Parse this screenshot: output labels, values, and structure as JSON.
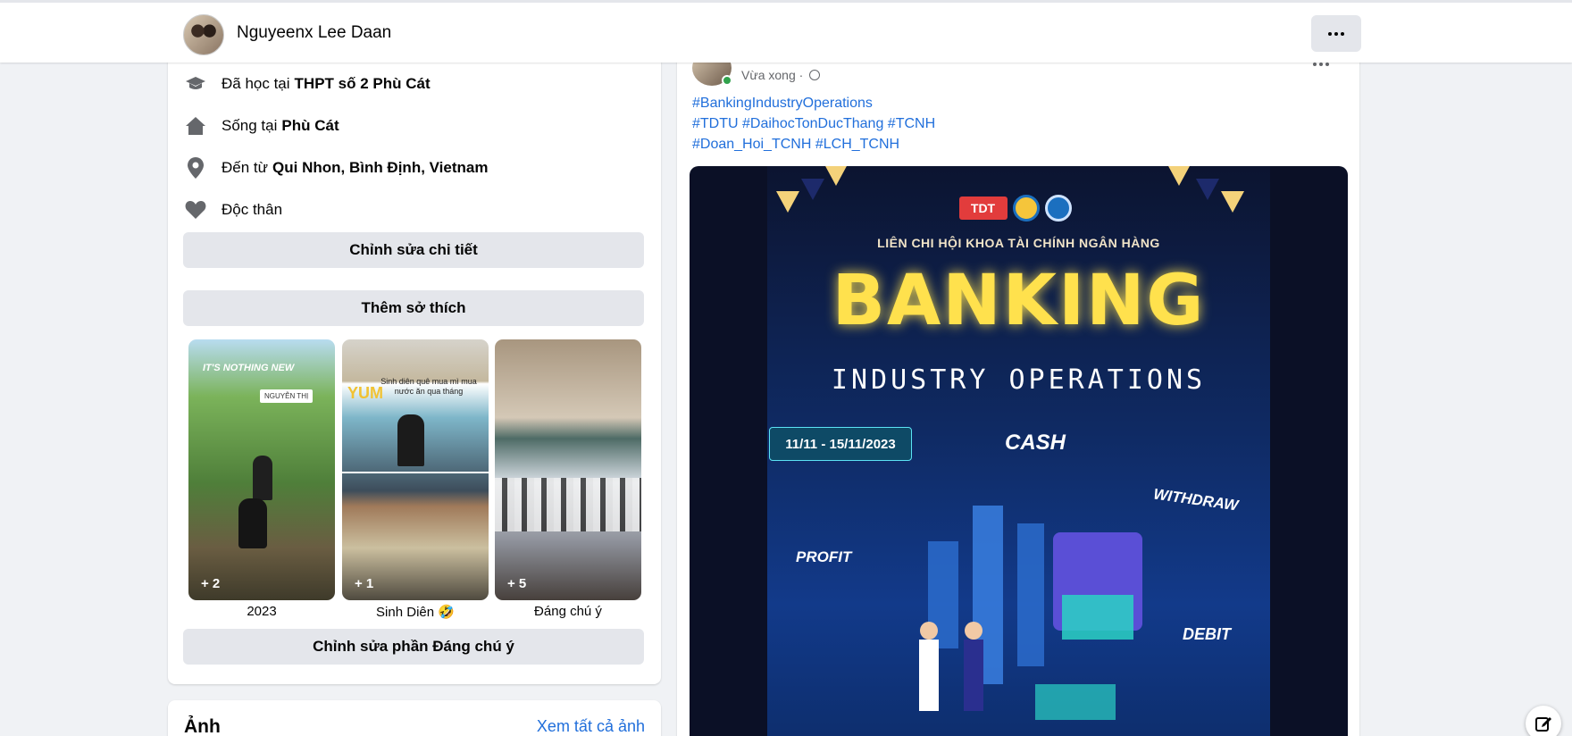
{
  "header": {
    "name": "Nguyeenx Lee Daan",
    "more_icon": "more-horizontal-icon"
  },
  "intro": {
    "items": [
      {
        "icon": "graduation-cap-icon",
        "prefix": "Đã học tại",
        "value": "THPT số 2 Phù Cát"
      },
      {
        "icon": "home-icon",
        "prefix": "Sống tại",
        "value": "Phù Cát"
      },
      {
        "icon": "location-pin-icon",
        "prefix": "Đến từ",
        "value": "Qui Nhon, Bình Định, Vietnam"
      },
      {
        "icon": "heart-icon",
        "prefix": "Độc thân",
        "value": ""
      }
    ],
    "edit_details_label": "Chỉnh sửa chi tiết",
    "add_hobbies_label": "Thêm sở thích",
    "highlights": [
      {
        "label": "2023",
        "count": "+ 2",
        "overlay_text": "IT'S NOTHING NEW",
        "tag": "NGUYỄN THỊ"
      },
      {
        "label": "Sinh Diên 🤣",
        "count": "+ 1",
        "overlay_text": "Sinh diên quê mua mì mua nước ăn qua tháng",
        "tag": "YUM"
      },
      {
        "label": "Đáng chú ý",
        "count": "+ 5",
        "overlay_text": "",
        "tag": ""
      }
    ],
    "edit_featured_label": "Chỉnh sửa phần Đáng chú ý"
  },
  "photos": {
    "title": "Ảnh",
    "see_all": "Xem tất cả ảnh"
  },
  "post": {
    "time": "Vừa xong ·",
    "privacy_icon": "globe-icon",
    "hashtags": [
      [
        "#BankingIndustryOperations"
      ],
      [
        "#TDTU",
        "#DaihocTonDucThang",
        "#TCNH"
      ],
      [
        "#Doan_Hoi_TCNH",
        "#LCH_TCNH"
      ]
    ],
    "poster": {
      "logo_text": "TDT",
      "subtitle": "LIÊN CHI HỘI KHOA TÀI CHÍNH NGÂN HÀNG",
      "title": "BANKING",
      "subtitle2": "INDUSTRY OPERATIONS",
      "date": "11/11 - 15/11/2023",
      "words": [
        "CASH",
        "WITHDRAW",
        "PROFIT",
        "DEBIT"
      ]
    }
  },
  "compose_icon": "compose-icon",
  "colors": {
    "accent": "#216fdb",
    "button_gray": "#e4e6eb",
    "background": "#f0f2f5",
    "poster_title": "#ffe14d"
  }
}
